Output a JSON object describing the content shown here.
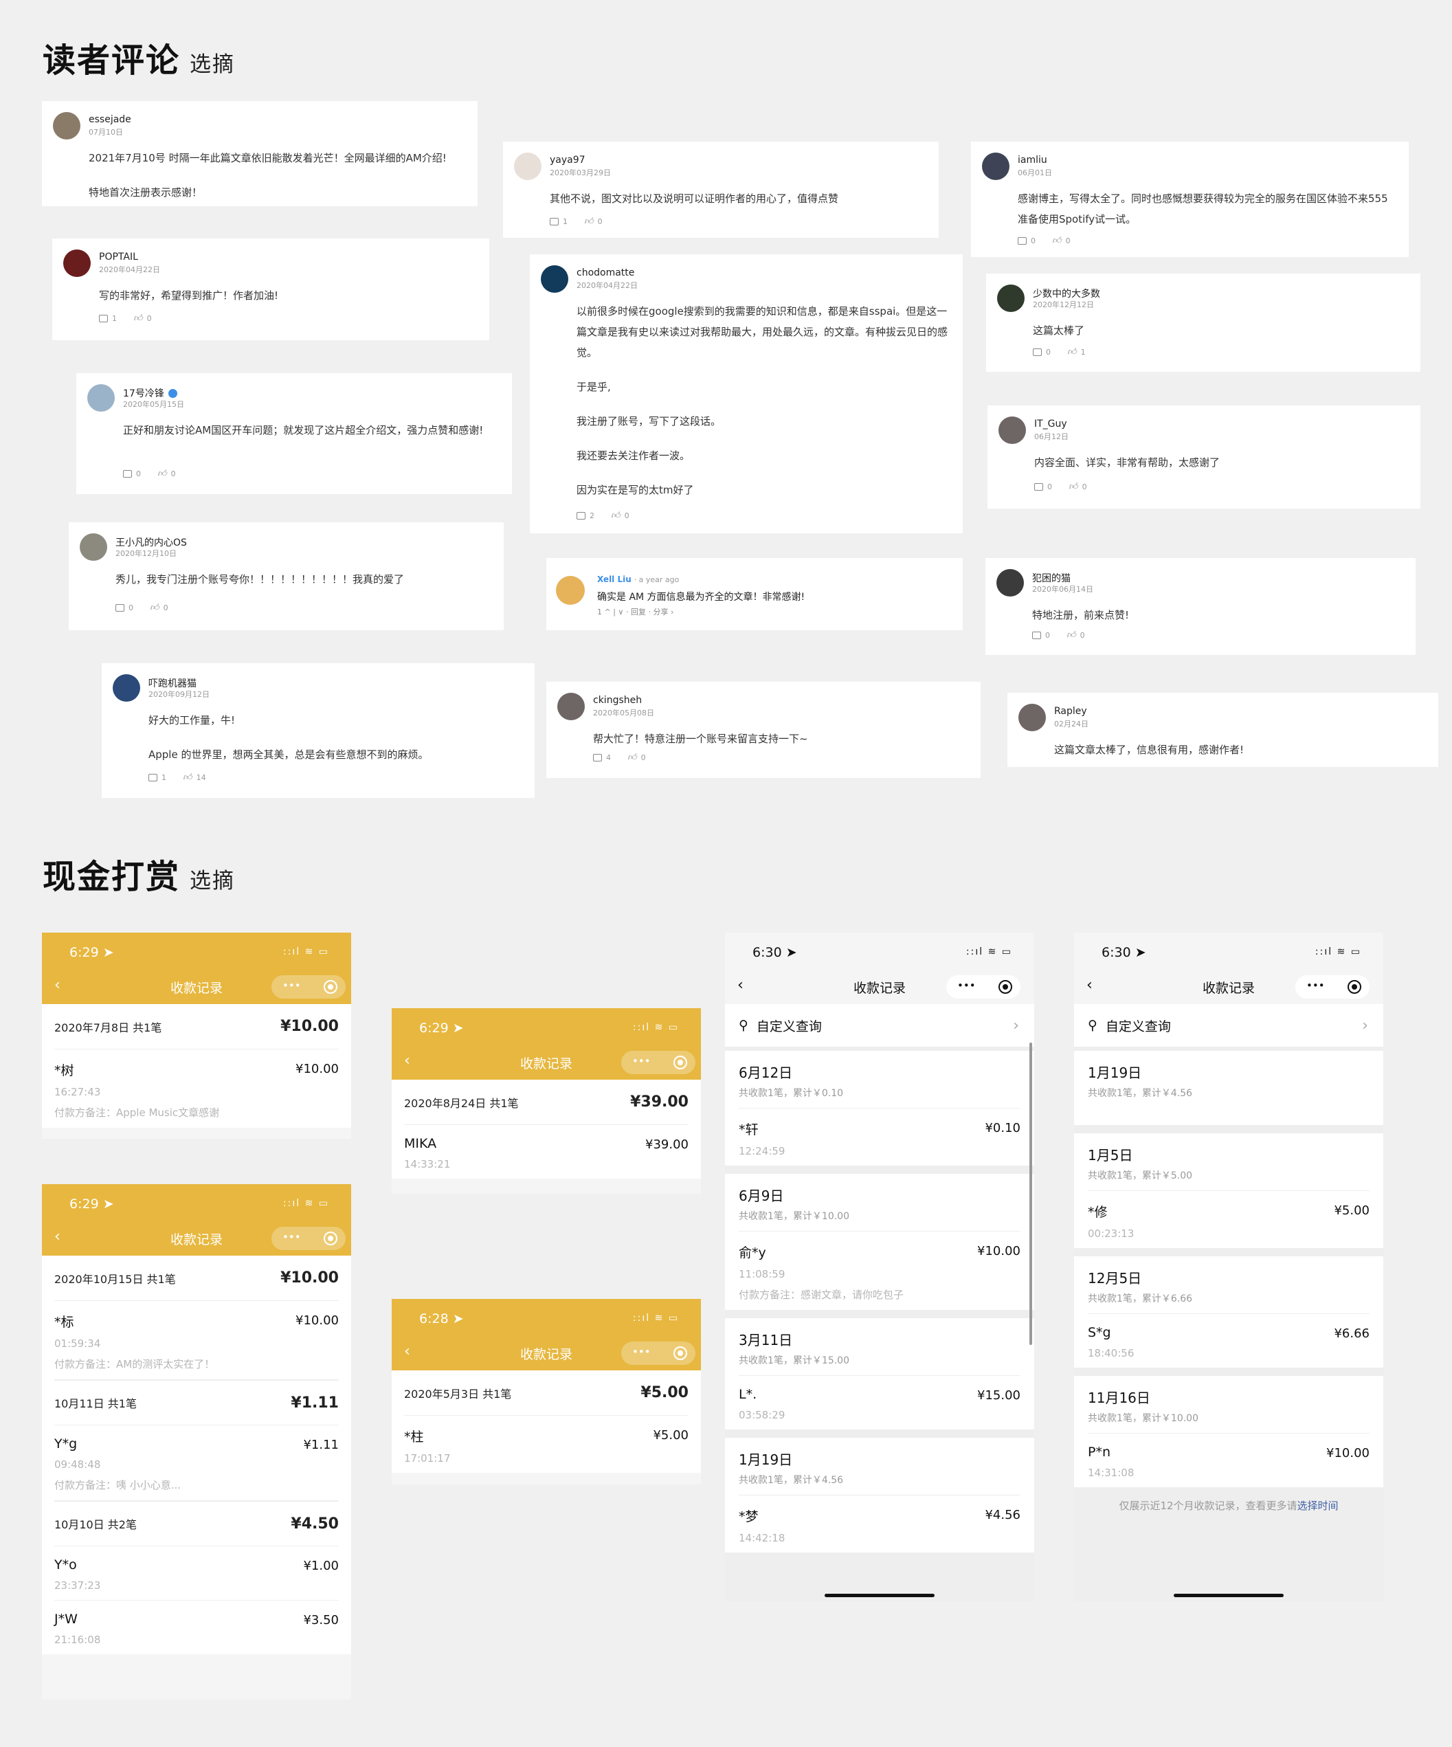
{
  "sections": {
    "comments_title": "读者评论",
    "comments_sub": "选摘",
    "reward_title": "现金打赏",
    "reward_sub": "选摘"
  },
  "comments": [
    {
      "user": "essejade",
      "date": "07月10日",
      "paragraphs": [
        "2021年7月10号 时隔一年此篇文章依旧能散发着光芒！全网最详细的AM介绍!",
        "特地首次注册表示感谢！"
      ]
    },
    {
      "user": "yaya97",
      "date": "2020年03月29日",
      "paragraphs": [
        "其他不说，图文对比以及说明可以证明作者的用心了，值得点赞"
      ],
      "replies": "1",
      "likes": "0"
    },
    {
      "user": "iamliu",
      "date": "06月01日",
      "paragraphs": [
        "感谢博主，写得太全了。同时也感慨想要获得较为完全的服务在国区体验不来555 准备使用Spotify试一试。"
      ],
      "replies": "0",
      "likes": "0"
    },
    {
      "user": "POPTAIL",
      "date": "2020年04月22日",
      "paragraphs": [
        "写的非常好，希望得到推广！作者加油!"
      ],
      "replies": "1",
      "likes": "0"
    },
    {
      "user": "chodomatte",
      "date": "2020年04月22日",
      "paragraphs": [
        "以前很多时候在google搜索到的我需要的知识和信息，都是来自sspai。但是这一篇文章是我有史以来读过对我帮助最大，用处最久远，的文章。有种拔云见日的感觉。",
        "于是乎,",
        "我注册了账号，写下了这段话。",
        "我还要去关注作者一波。",
        "因为实在是写的太tm好了"
      ],
      "replies": "2",
      "likes": "0"
    },
    {
      "user": "少数中的大多数",
      "date": "2020年12月12日",
      "paragraphs": [
        "这篇太棒了"
      ],
      "replies": "0",
      "likes": "1"
    },
    {
      "user": "17号冷锋",
      "date": "2020年05月15日",
      "paragraphs": [
        "正好和朋友讨论AM国区开车问题；就发现了这片超全介绍文，强力点赞和感谢!"
      ],
      "replies": "0",
      "likes": "0"
    },
    {
      "user": "IT_Guy",
      "date": "06月12日",
      "paragraphs": [
        "内容全面、详实，非常有帮助，太感谢了"
      ],
      "replies": "0",
      "likes": "0"
    },
    {
      "user": "王小凡的内心OS",
      "date": "2020年12月10日",
      "paragraphs": [
        "秀儿，我专门注册个账号夸你！！！！！！！！！！我真的爱了"
      ],
      "replies": "0",
      "likes": "0"
    },
    {
      "user": "Xell Liu",
      "ago": "· a year ago",
      "text": "确实是 AM 方面信息最为齐全的文章！非常感谢!",
      "meta": "1 ^ | ∨ · 回复 · 分享 ›"
    },
    {
      "user": "犯困的猫",
      "date": "2020年06月14日",
      "paragraphs": [
        "特地注册，前来点赞!"
      ],
      "replies": "0",
      "likes": "0"
    },
    {
      "user": "吓跑机器猫",
      "date": "2020年09月12日",
      "paragraphs": [
        "好大的工作量，牛!",
        "Apple 的世界里，想两全其美，总是会有些意想不到的麻烦。"
      ],
      "replies": "1",
      "likes": "14"
    },
    {
      "user": "ckingsheh",
      "date": "2020年05月08日",
      "paragraphs": [
        "帮大忙了！特意注册一个账号来留言支持一下~"
      ],
      "replies": "4",
      "likes": "0"
    },
    {
      "user": "Rapley",
      "date": "02月24日",
      "paragraphs": [
        "这篇文章太棒了，信息很有用，感谢作者!"
      ]
    }
  ],
  "phone_common": {
    "title": "收款记录",
    "signal": "::ıl ≋ ▭",
    "back": "‹",
    "dots": "•••",
    "search": "自定义查询",
    "search_arrow": "›",
    "footer": "仅展示近12个月收款记录，查看更多请",
    "footer_link": "选择时间",
    "location_icon": "➤"
  },
  "p1": {
    "time": "6:29",
    "day": "2020年7月8日 共1笔",
    "total": "¥10.00",
    "recs": [
      {
        "name": "*树",
        "amount": "¥10.00",
        "time": "16:27:43",
        "note": "付款方备注：Apple Music文章感谢"
      }
    ]
  },
  "p2": {
    "time": "6:29",
    "day": "2020年8月24日 共1笔",
    "total": "¥39.00",
    "recs": [
      {
        "name": "MIKA",
        "amount": "¥39.00",
        "time": "14:33:21"
      }
    ]
  },
  "p3": {
    "time": "6:29",
    "days": [
      {
        "day": "2020年10月15日 共1笔",
        "total": "¥10.00",
        "recs": [
          {
            "name": "*标",
            "amount": "¥10.00",
            "time": "01:59:34",
            "note": "付款方备注：AM的测评太实在了！"
          }
        ]
      },
      {
        "day": "10月11日 共1笔",
        "total": "¥1.11",
        "recs": [
          {
            "name": "Y*g",
            "amount": "¥1.11",
            "time": "09:48:48",
            "note": "付款方备注：咦 小小心意..."
          }
        ]
      },
      {
        "day": "10月10日 共2笔",
        "total": "¥4.50",
        "recs": [
          {
            "name": "Y*o",
            "amount": "¥1.00",
            "time": "23:37:23"
          },
          {
            "name": "J*W",
            "amount": "¥3.50",
            "time": "21:16:08"
          }
        ]
      }
    ]
  },
  "p4": {
    "time": "6:28",
    "day": "2020年5月3日 共1笔",
    "total": "¥5.00",
    "recs": [
      {
        "name": "*柱",
        "amount": "¥5.00",
        "time": "17:01:17"
      }
    ]
  },
  "p5": {
    "time": "6:30",
    "months": [
      {
        "title": "6月12日",
        "sub": "共收款1笔，累计￥0.10",
        "recs": [
          {
            "name": "*轩",
            "amount": "¥0.10",
            "time": "12:24:59"
          }
        ]
      },
      {
        "title": "6月9日",
        "sub": "共收款1笔，累计￥10.00",
        "recs": [
          {
            "name": "俞*y",
            "amount": "¥10.00",
            "time": "11:08:59",
            "note": "付款方备注：感谢文章，请你吃包子"
          }
        ]
      },
      {
        "title": "3月11日",
        "sub": "共收款1笔，累计￥15.00",
        "recs": [
          {
            "name": "L*.",
            "amount": "¥15.00",
            "time": "03:58:29"
          }
        ]
      },
      {
        "title": "1月19日",
        "sub": "共收款1笔，累计￥4.56",
        "recs": [
          {
            "name": "*梦",
            "amount": "¥4.56",
            "time": "14:42:18"
          }
        ]
      }
    ]
  },
  "p6": {
    "time": "6:30",
    "months": [
      {
        "title": "1月19日",
        "sub": "共收款1笔，累计￥4.56",
        "recs": []
      },
      {
        "title": "1月5日",
        "sub": "共收款1笔，累计￥5.00",
        "recs": [
          {
            "name": "*修",
            "amount": "¥5.00",
            "time": "00:23:13"
          }
        ]
      },
      {
        "title": "12月5日",
        "sub": "共收款1笔，累计￥6.66",
        "recs": [
          {
            "name": "S*g",
            "amount": "¥6.66",
            "time": "18:40:56"
          }
        ]
      },
      {
        "title": "11月16日",
        "sub": "共收款1笔，累计￥10.00",
        "recs": [
          {
            "name": "P*n",
            "amount": "¥10.00",
            "time": "14:31:08"
          }
        ]
      }
    ]
  },
  "colors": {
    "brand_yellow": "#e7b73f",
    "link_blue": "#3d5fa3"
  }
}
